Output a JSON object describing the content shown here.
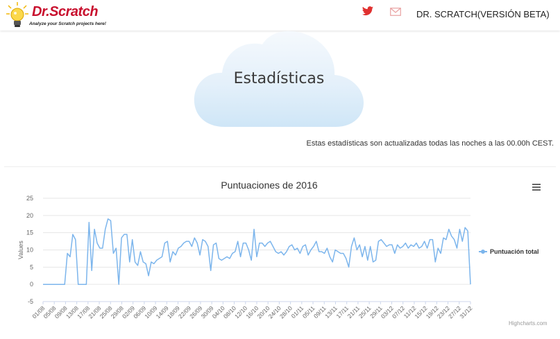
{
  "header": {
    "logo_title": "Dr.Scratch",
    "logo_subtitle": "Analyze your Scratch projects here!",
    "brand": "DR. SCRATCH(VERSIÓN BETA)",
    "icons": [
      "twitter-icon",
      "mail-icon"
    ],
    "accent_color": "#e0302f"
  },
  "hero": {
    "title": "Estadísticas",
    "note": "Estas estadísticas son actualizadas todas las noches a las 00.00h CEST."
  },
  "chart_data": {
    "type": "line",
    "title": "Puntuaciones de 2016",
    "xlabel": "",
    "ylabel": "Values",
    "ylim": [
      -5,
      25
    ],
    "yticks": [
      -5,
      0,
      5,
      10,
      15,
      20,
      25
    ],
    "grid": true,
    "legend_position": "right",
    "categories": [
      "01/08",
      "05/08",
      "09/08",
      "13/08",
      "17/08",
      "21/08",
      "25/08",
      "29/08",
      "02/09",
      "06/09",
      "10/09",
      "14/09",
      "18/09",
      "22/09",
      "26/09",
      "30/09",
      "04/10",
      "08/10",
      "12/10",
      "16/10",
      "20/10",
      "24/10",
      "28/10",
      "01/11",
      "05/11",
      "09/11",
      "13/11",
      "17/11",
      "21/11",
      "25/11",
      "29/11",
      "03/12",
      "07/12",
      "11/12",
      "15/12",
      "19/12",
      "23/12",
      "27/12",
      "31/12"
    ],
    "series": [
      {
        "name": "Puntuación total",
        "color": "#7cb5ec",
        "values": [
          0,
          0,
          0,
          0,
          0,
          0,
          0,
          0,
          0,
          9,
          8,
          14.5,
          13,
          0,
          0,
          0,
          0,
          18,
          4,
          16,
          12,
          10.5,
          10.5,
          16,
          19,
          18.5,
          9,
          10.5,
          0,
          13.5,
          14.5,
          14.5,
          6.5,
          13,
          6.5,
          5.5,
          9.5,
          6.5,
          6,
          2.5,
          6.5,
          6,
          7,
          7.5,
          8,
          12,
          12.5,
          6.5,
          9.5,
          8.5,
          10.5,
          11,
          12,
          12.5,
          12.5,
          11,
          13.5,
          12,
          8.5,
          13,
          12.5,
          11,
          4,
          11.5,
          12,
          7.5,
          7,
          7.5,
          8,
          7.5,
          9,
          9.5,
          12.5,
          8,
          12,
          12,
          10,
          7,
          16,
          8,
          12,
          12,
          11,
          12,
          12.5,
          11,
          9.5,
          9,
          9.5,
          8.5,
          9.5,
          11,
          11.5,
          10,
          10.5,
          9,
          11,
          11.5,
          8.5,
          10,
          11,
          12.5,
          9.5,
          9.5,
          9,
          10.5,
          8,
          6.5,
          10,
          9.5,
          9,
          9,
          7.5,
          5,
          11,
          13.5,
          10,
          11.5,
          8,
          11,
          7,
          11,
          6.5,
          7,
          12.5,
          13,
          12,
          11,
          11.5,
          11.5,
          9,
          11.5,
          10.5,
          11,
          12,
          10.5,
          11.5,
          11,
          12,
          10.5,
          11,
          12.5,
          10.5,
          13,
          13,
          6.5,
          10.5,
          9,
          13.5,
          13,
          16,
          14,
          13,
          10.5,
          16,
          12.5,
          16.5,
          15.5,
          0
        ]
      }
    ]
  },
  "credits": "Highcharts.com"
}
